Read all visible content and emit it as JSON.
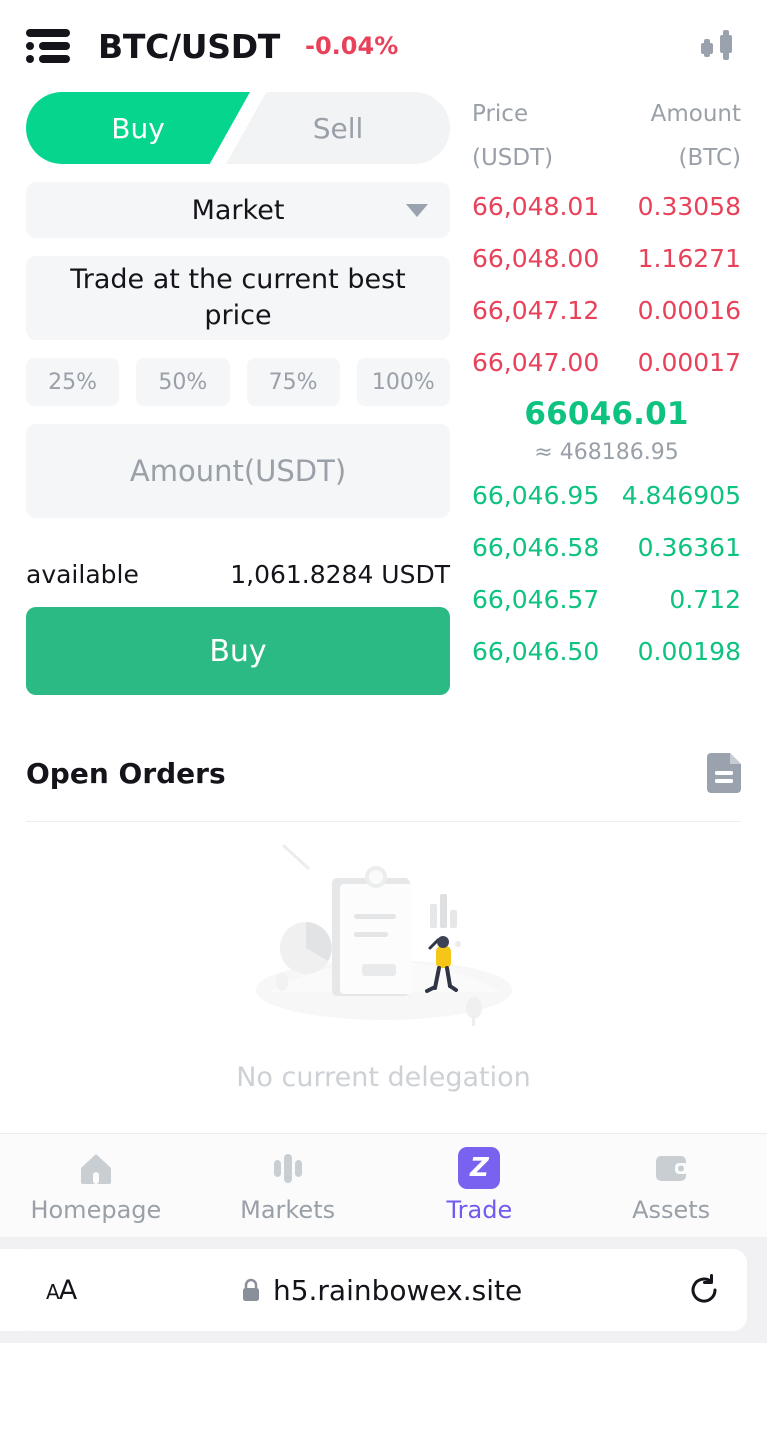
{
  "header": {
    "menu_icon": "list-menu-icon",
    "pair": "BTC/USDT",
    "change": "-0.04%",
    "change_color": "#e8425a",
    "chart_icon": "candlestick-chart-icon"
  },
  "order_form": {
    "tabs": [
      {
        "label": "Buy",
        "active": true
      },
      {
        "label": "Sell",
        "active": false
      }
    ],
    "order_type": "Market",
    "order_type_hint": "Trade at the current best price",
    "percent_options": [
      "25%",
      "50%",
      "75%",
      "100%"
    ],
    "amount_placeholder": "Amount(USDT)",
    "amount_value": "",
    "available_label": "available",
    "available_value": "1,061.8284 USDT",
    "submit_label": "Buy",
    "submit_color": "#2bba84",
    "tab_active_color": "#06d68d"
  },
  "orderbook": {
    "col_price": "Price",
    "col_price_unit": "(USDT)",
    "col_amount": "Amount",
    "col_amount_unit": "(BTC)",
    "ask_color": "#e8425a",
    "bid_color": "#0ec27f",
    "asks": [
      {
        "price": "66,048.01",
        "amount": "0.33058"
      },
      {
        "price": "66,048.00",
        "amount": "1.16271"
      },
      {
        "price": "66,047.12",
        "amount": "0.00016"
      },
      {
        "price": "66,047.00",
        "amount": "0.00017"
      }
    ],
    "mid_price": "66046.01",
    "mid_approx": "≈ 468186.95",
    "bids": [
      {
        "price": "66,046.95",
        "amount": "4.846905"
      },
      {
        "price": "66,046.58",
        "amount": "0.36361"
      },
      {
        "price": "66,046.57",
        "amount": "0.712"
      },
      {
        "price": "66,046.50",
        "amount": "0.00198"
      }
    ]
  },
  "open_orders": {
    "title": "Open Orders",
    "history_icon": "document-icon",
    "empty_illustration": "empty-orders-illustration",
    "empty_text": "No current delegation"
  },
  "bottom_nav": {
    "active_color": "#6f5bf0",
    "items": [
      {
        "label": "Homepage",
        "icon": "home-icon",
        "active": false
      },
      {
        "label": "Markets",
        "icon": "bar-chart-icon",
        "active": false
      },
      {
        "label": "Trade",
        "icon": "trade-badge-icon",
        "active": true
      },
      {
        "label": "Assets",
        "icon": "wallet-icon",
        "active": false
      }
    ]
  },
  "browser": {
    "text_size_label": "AA",
    "lock_icon": "lock-icon",
    "url": "h5.rainbowex.site",
    "reload_icon": "reload-icon"
  }
}
